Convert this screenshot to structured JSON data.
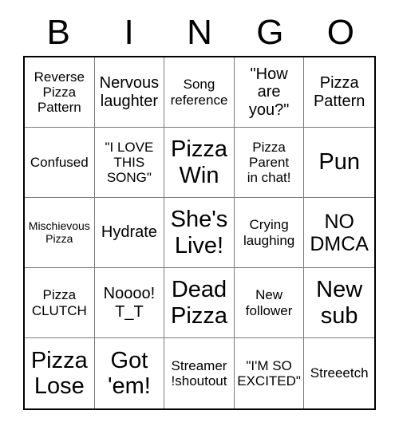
{
  "title": "Bingo Card",
  "header": {
    "letters": [
      "B",
      "I",
      "N",
      "G",
      "O"
    ]
  },
  "grid": {
    "columns": 5,
    "rows": 5,
    "border_color": "#000000",
    "line_color": "#7a7a7a",
    "background": "#ffffff",
    "text_color": "#000000",
    "cells": [
      {
        "text": "Reverse\nPizza\nPattern",
        "size": "sm"
      },
      {
        "text": "Nervous\nlaughter",
        "size": "md"
      },
      {
        "text": "Song\nreference",
        "size": "sm"
      },
      {
        "text": "\"How\nare\nyou?\"",
        "size": "md"
      },
      {
        "text": "Pizza\nPattern",
        "size": "md"
      },
      {
        "text": "Confused",
        "size": "sm"
      },
      {
        "text": "\"I LOVE\nTHIS\nSONG\"",
        "size": "sm"
      },
      {
        "text": "Pizza\nWin",
        "size": "xl"
      },
      {
        "text": "Pizza\nParent\nin chat!",
        "size": "sm"
      },
      {
        "text": "Pun",
        "size": "xl"
      },
      {
        "text": "Mischievous\nPizza",
        "size": "xs"
      },
      {
        "text": "Hydrate",
        "size": "md"
      },
      {
        "text": "She's\nLive!",
        "size": "xl"
      },
      {
        "text": "Crying\nlaughing",
        "size": "sm"
      },
      {
        "text": "NO\nDMCA",
        "size": "lg"
      },
      {
        "text": "Pizza\nCLUTCH",
        "size": "sm"
      },
      {
        "text": "Noooo!\nT_T",
        "size": "md"
      },
      {
        "text": "Dead\nPizza",
        "size": "xl"
      },
      {
        "text": "New\nfollower",
        "size": "sm"
      },
      {
        "text": "New\nsub",
        "size": "xl"
      },
      {
        "text": "Pizza\nLose",
        "size": "xl"
      },
      {
        "text": "Got\n'em!",
        "size": "xl"
      },
      {
        "text": "Streamer\n!shoutout",
        "size": "sm"
      },
      {
        "text": "\"I'M SO\nEXCITED\"",
        "size": "sm"
      },
      {
        "text": "Streeetch",
        "size": "sm"
      }
    ]
  }
}
